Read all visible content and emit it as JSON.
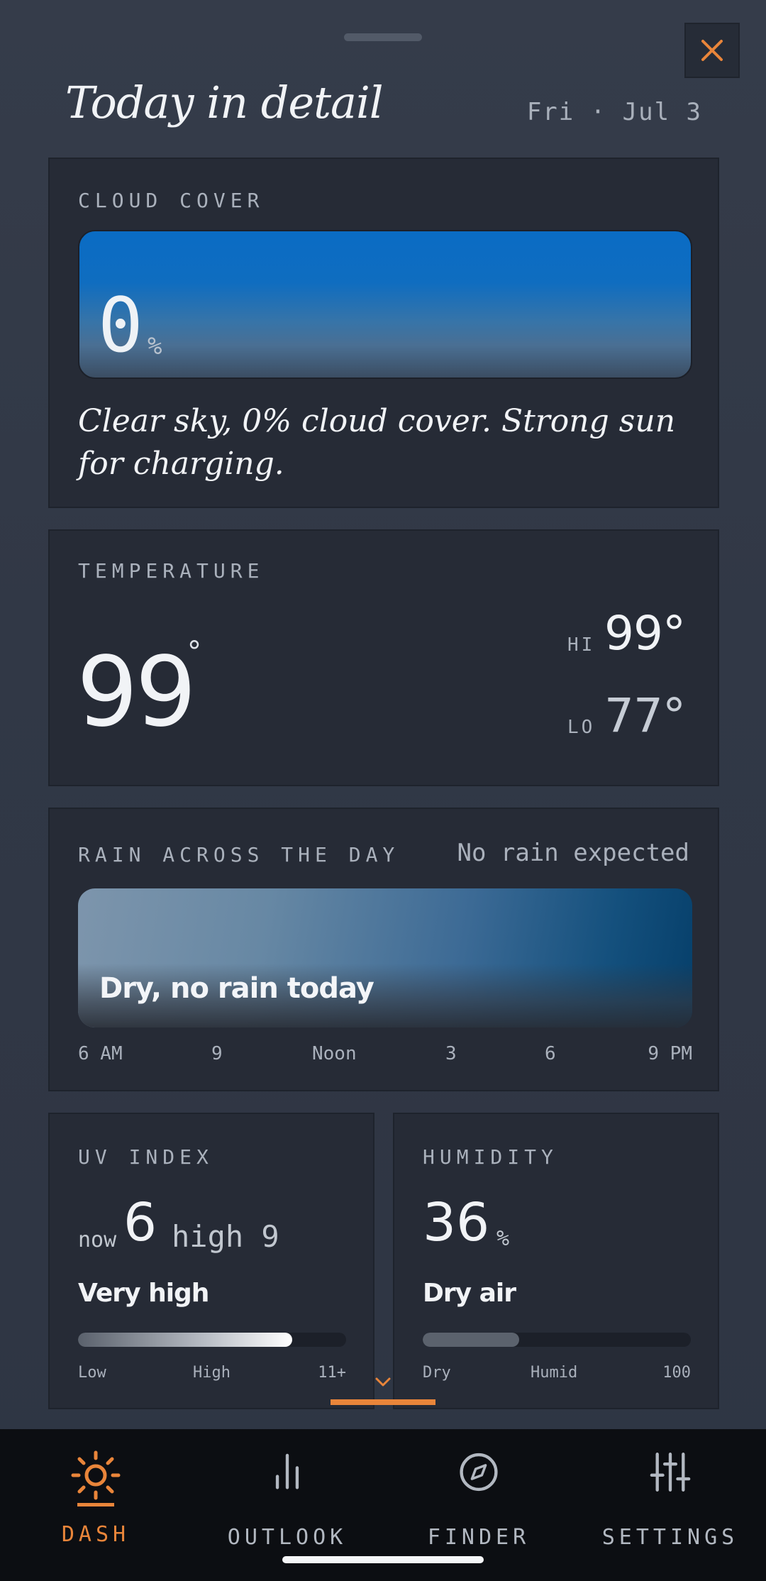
{
  "header": {
    "title": "Today in detail",
    "date": "Fri · Jul 3"
  },
  "cloud": {
    "label": "CLOUD COVER",
    "value": "0",
    "unit": "%",
    "description": "Clear sky, 0% cloud cover. Strong sun for charging."
  },
  "temperature": {
    "label": "TEMPERATURE",
    "current": "99",
    "degree_symbol": "°",
    "hi_label": "HI",
    "hi_value": "99°",
    "lo_label": "LO",
    "lo_value": "77°"
  },
  "rain": {
    "label": "RAIN ACROSS THE DAY",
    "status": "No rain expected",
    "summary": "Dry, no rain today",
    "ticks": [
      "6 AM",
      "9",
      "Noon",
      "3",
      "6",
      "9 PM"
    ]
  },
  "uv": {
    "label": "UV INDEX",
    "now_label": "now",
    "now_value": "6",
    "high_text": "high 9",
    "level": "Very high",
    "fill_fraction": 0.8,
    "scale_labels": [
      "Low",
      "High",
      "11+"
    ]
  },
  "humidity": {
    "label": "HUMIDITY",
    "value": "36",
    "unit": "%",
    "level": "Dry air",
    "fill_fraction": 0.36,
    "scale_labels": [
      "Dry",
      "Humid",
      "100"
    ]
  },
  "nav": {
    "items": [
      {
        "label": "DASH",
        "icon": "sun-icon",
        "active": true
      },
      {
        "label": "OUTLOOK",
        "icon": "bar-chart-icon",
        "active": false
      },
      {
        "label": "FINDER",
        "icon": "compass-icon",
        "active": false
      },
      {
        "label": "SETTINGS",
        "icon": "sliders-icon",
        "active": false
      }
    ]
  },
  "colors": {
    "accent": "#e9853a",
    "background": "#313846",
    "card": "#262b36",
    "nav_background": "#0c0e12"
  }
}
